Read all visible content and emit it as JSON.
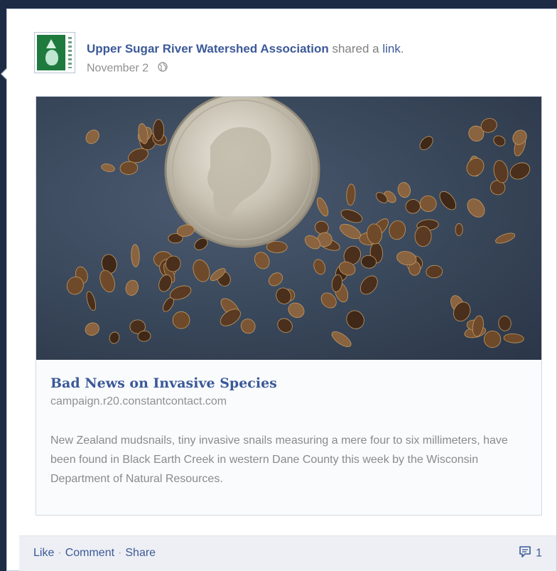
{
  "post": {
    "author": "Upper Sugar River Watershed Association",
    "action_prefix": "shared a",
    "action_link": "link",
    "action_suffix": ".",
    "date": "November 2",
    "privacy_icon": "globe-icon"
  },
  "attachment": {
    "image_icon": "snails-and-dime-photo",
    "title": "Bad News on Invasive Species",
    "domain": "campaign.r20.constantcontact.com",
    "description": "New Zealand mudsnails, tiny invasive snails measuring a mere four to six millimeters, have been found in Black Earth Creek in western Dane County this week by the Wisconsin Department of Natural Resources."
  },
  "footer": {
    "like": "Like",
    "comment": "Comment",
    "share": "Share",
    "separator": "·",
    "comment_icon": "comment-icon",
    "comment_count": "1"
  },
  "colors": {
    "link_blue": "#3b5998",
    "page_background": "#1d2b45",
    "footer_background": "#edeff4"
  }
}
